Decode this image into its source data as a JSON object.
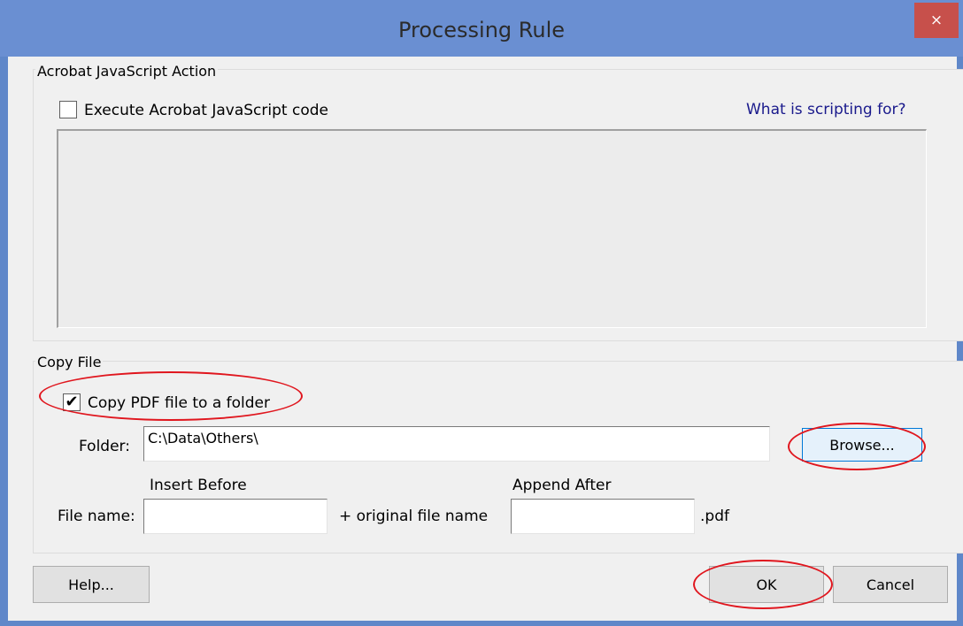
{
  "window": {
    "title": "Processing Rule",
    "close_glyph": "×"
  },
  "js_section": {
    "group_label": "Acrobat JavaScript Action",
    "checkbox_label": "Execute Acrobat JavaScript code",
    "checked": false,
    "help_link": "What is scripting for?",
    "code": ""
  },
  "copy_section": {
    "group_label": "Copy File",
    "checkbox_label": "Copy PDF file to a folder",
    "checked": true,
    "check_glyph": "✔",
    "folder_label": "Folder:",
    "folder_value": "C:\\Data\\Others\\",
    "browse_label": "Browse...",
    "insert_before_label": "Insert Before",
    "append_after_label": "Append After",
    "file_name_label": "File name:",
    "insert_before_value": "",
    "original_name_text": "+ original file name",
    "append_after_value": "",
    "extension_text": ".pdf"
  },
  "footer": {
    "help_label": "Help...",
    "ok_label": "OK",
    "cancel_label": "Cancel"
  },
  "colors": {
    "title_bar": "#6a8fd2",
    "close_button": "#c7504b",
    "annotation": "#e0161e",
    "link": "#1a1a8c"
  }
}
